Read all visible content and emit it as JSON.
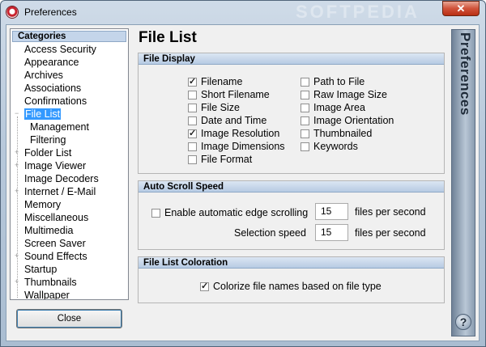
{
  "window": {
    "title": "Preferences",
    "close_glyph": "✕"
  },
  "sidebar": {
    "header": "Categories",
    "items": [
      {
        "label": "Access Security",
        "expandable": false
      },
      {
        "label": "Appearance",
        "expandable": false
      },
      {
        "label": "Archives",
        "expandable": false
      },
      {
        "label": "Associations",
        "expandable": false
      },
      {
        "label": "Confirmations",
        "expandable": false
      },
      {
        "label": "File List",
        "expandable": true,
        "expanded": true,
        "selected": true
      },
      {
        "label": "Management",
        "child": true
      },
      {
        "label": "Filtering",
        "child": true
      },
      {
        "label": "Folder List",
        "expandable": true
      },
      {
        "label": "Image Viewer",
        "expandable": true
      },
      {
        "label": "Image Decoders",
        "expandable": false
      },
      {
        "label": "Internet / E-Mail",
        "expandable": true
      },
      {
        "label": "Memory",
        "expandable": false
      },
      {
        "label": "Miscellaneous",
        "expandable": false
      },
      {
        "label": "Multimedia",
        "expandable": false
      },
      {
        "label": "Screen Saver",
        "expandable": false
      },
      {
        "label": "Sound Effects",
        "expandable": true
      },
      {
        "label": "Startup",
        "expandable": false
      },
      {
        "label": "Thumbnails",
        "expandable": true
      },
      {
        "label": "Wallpaper",
        "expandable": false
      }
    ],
    "close_button": "Close"
  },
  "main": {
    "title": "File List",
    "file_display": {
      "header": "File Display",
      "left": [
        {
          "label": "Filename",
          "checked": true
        },
        {
          "label": "Short Filename",
          "checked": false
        },
        {
          "label": "File Size",
          "checked": false
        },
        {
          "label": "Date and Time",
          "checked": false
        },
        {
          "label": "Image Resolution",
          "checked": true
        },
        {
          "label": "Image Dimensions",
          "checked": false
        },
        {
          "label": "File Format",
          "checked": false
        }
      ],
      "right": [
        {
          "label": "Path to File",
          "checked": false
        },
        {
          "label": "Raw Image Size",
          "checked": false
        },
        {
          "label": "Image Area",
          "checked": false
        },
        {
          "label": "Image Orientation",
          "checked": false
        },
        {
          "label": "Thumbnailed",
          "checked": false
        },
        {
          "label": "Keywords",
          "checked": false
        }
      ]
    },
    "auto_scroll": {
      "header": "Auto Scroll Speed",
      "edge_label": "Enable automatic edge scrolling",
      "edge_checked": false,
      "edge_value": "15",
      "edge_unit": "files per second",
      "selection_label": "Selection speed",
      "selection_value": "15",
      "selection_unit": "files per second"
    },
    "coloration": {
      "header": "File List Coloration",
      "colorize_label": "Colorize file names based on file type",
      "colorize_checked": true
    }
  },
  "banner": {
    "text": "Preferences",
    "help_glyph": "?"
  },
  "watermark": "SOFTPEDIA"
}
